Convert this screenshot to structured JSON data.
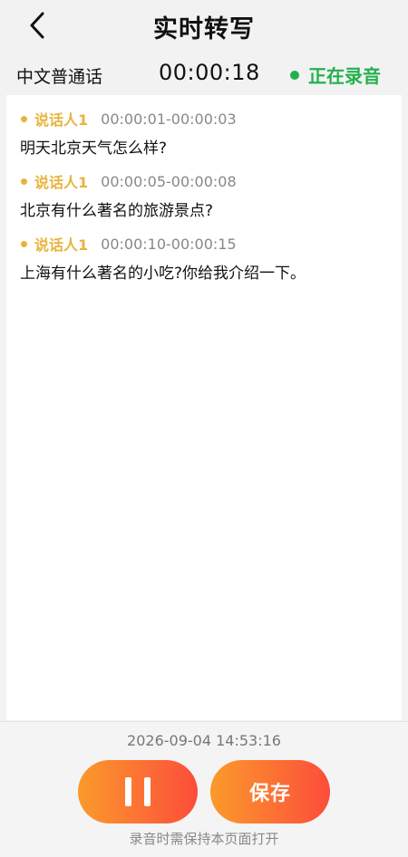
{
  "header": {
    "title": "实时转写",
    "back_icon": "chevron-left-icon"
  },
  "status": {
    "language": "中文普通话",
    "timer": "00:00:18",
    "recording_label": "正在录音",
    "recording_color": "#22b14c"
  },
  "transcript": {
    "speaker_color": "#e8b33d",
    "entries": [
      {
        "speaker": "说话人1",
        "time_range": "00:00:01-00:00:03",
        "text": "明天北京天气怎么样?"
      },
      {
        "speaker": "说话人1",
        "time_range": "00:00:05-00:00:08",
        "text": "北京有什么著名的旅游景点?"
      },
      {
        "speaker": "说话人1",
        "time_range": "00:00:10-00:00:15",
        "text": "上海有什么著名的小吃?你给我介绍一下。"
      }
    ]
  },
  "footer": {
    "datetime": "2026-09-04 14:53:16",
    "pause_icon": "pause-icon",
    "save_label": "保存",
    "hint": "录音时需保持本页面打开",
    "button_gradient": [
      "#fb9a2c",
      "#fd4d3a"
    ]
  }
}
